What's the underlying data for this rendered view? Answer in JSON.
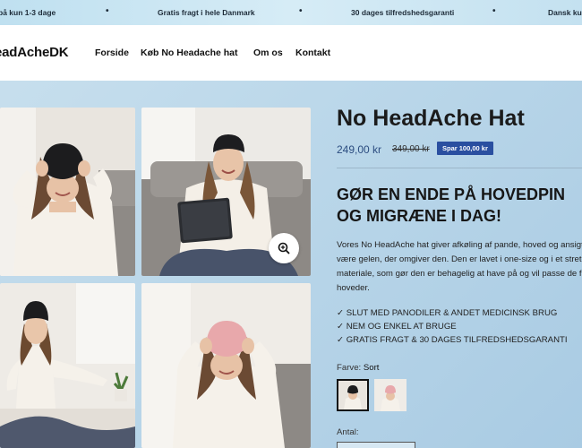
{
  "announcement": {
    "items": [
      "på kun 1-3 dage",
      "Gratis fragt i hele Danmark",
      "30 dages tilfredshedsgaranti",
      "Dansk ku"
    ],
    "separator": "•"
  },
  "header": {
    "logo": "eadAcheDK",
    "nav": [
      "Forside",
      "Køb No Headache hat",
      "Om os",
      "Kontakt"
    ]
  },
  "gallery": {
    "images": [
      {
        "alt": "woman-black-hat-over-eyes"
      },
      {
        "alt": "woman-black-hat-tablet"
      },
      {
        "alt": "woman-black-hat-meditating"
      },
      {
        "alt": "woman-pink-hat-over-eyes"
      }
    ]
  },
  "product": {
    "title": "No HeadAche Hat",
    "price": "249,00 kr",
    "old_price": "349,00 kr",
    "save_badge": "Spar 100,00 kr",
    "headline_line1": "GØR EN ENDE PÅ HOVEDPIN",
    "headline_line2": "OG MIGRÆNE I DAG!",
    "description_lines": [
      "Vores No HeadAche hat giver afkøling af pande, hoved og ansigt",
      "være gelen, der omgiver den. Den er lavet i one-size og i et stretc",
      "materiale, som gør den er behagelig at have på og vil passe de fle",
      "hoveder."
    ],
    "bullets": [
      "✓ SLUT MED PANODILER & ANDET MEDICINSK BRUG",
      "✓ NEM OG ENKEL AT BRUGE",
      "✓ GRATIS FRAGT & 30 DAGES TILFREDSHEDSGARANTI"
    ],
    "color_label": "Farve:",
    "color_value": "Sort",
    "quantity_label": "Antal:"
  },
  "colors": {
    "accent": "#2a4fa0",
    "price": "#2c4d80",
    "background": "#bcd8ea"
  }
}
